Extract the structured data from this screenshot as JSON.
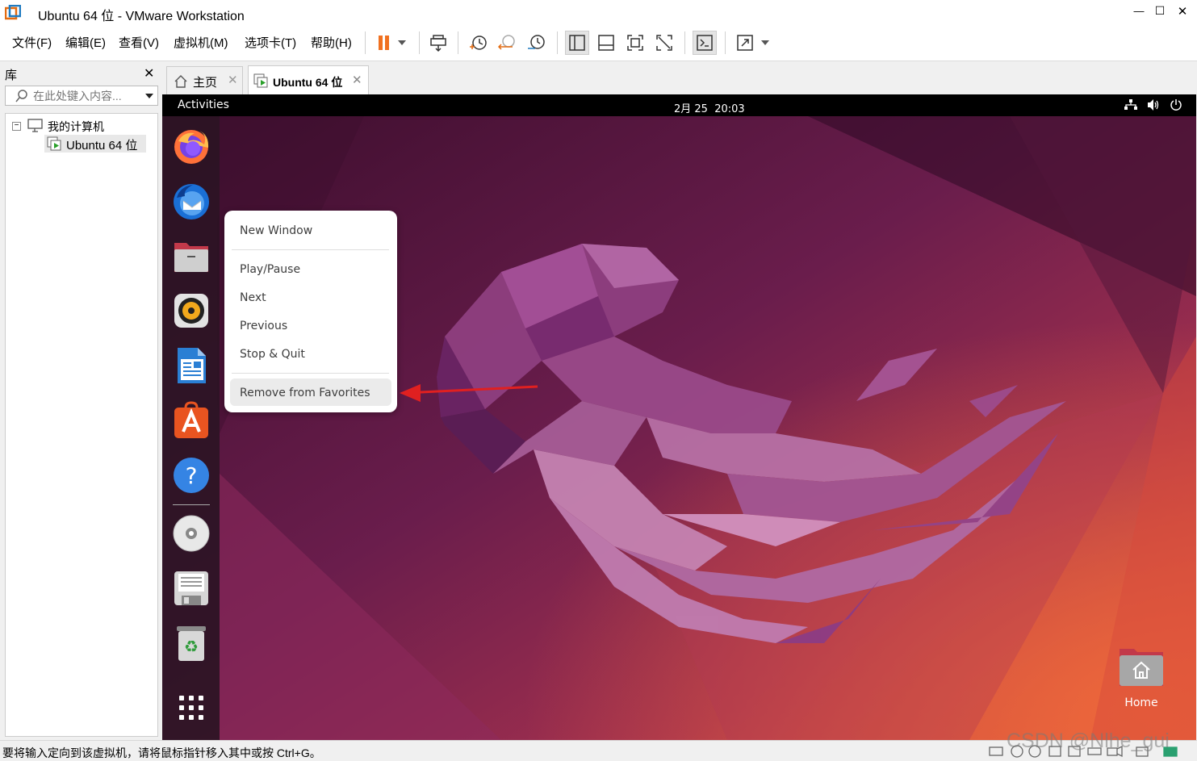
{
  "window": {
    "title": "Ubuntu 64 位 - VMware Workstation",
    "controls": [
      "—",
      "☐",
      "✕"
    ]
  },
  "menu": [
    "文件(F)",
    "编辑(E)",
    "查看(V)",
    "虚拟机(M)",
    "选项卡(T)",
    "帮助(H)"
  ],
  "library": {
    "title": "库",
    "search_placeholder": "在此处键入内容...",
    "tree": {
      "root": "我的计算机",
      "child": "Ubuntu 64 位"
    }
  },
  "tabs": [
    {
      "label": "主页",
      "icon": "home-icon",
      "active": false
    },
    {
      "label": "Ubuntu 64 位",
      "icon": "vm-icon",
      "active": true
    }
  ],
  "ubuntu": {
    "activities": "Activities",
    "clock": "2月 25  20:03",
    "desktop_home": "Home",
    "dock": [
      "firefox-icon",
      "thunderbird-icon",
      "files-icon",
      "rhythmbox-icon",
      "writer-icon",
      "software-icon",
      "help-icon",
      "dvd-icon",
      "floppy-icon",
      "trash-icon",
      "app-grid-icon"
    ],
    "context_menu": {
      "new_window": "New Window",
      "play_pause": "Play/Pause",
      "next": "Next",
      "previous": "Previous",
      "stop_quit": "Stop & Quit",
      "remove_fav": "Remove from Favorites"
    }
  },
  "status": {
    "text": "要将输入定向到该虚拟机，请将鼠标指针移入其中或按 Ctrl+G。",
    "watermark": "CSDN @Nlhe_gui"
  },
  "colors": {
    "accent_orange": "#e95420",
    "menu_highlight": "#ebebeb",
    "arrow": "#e02020",
    "pause": "#f07020"
  }
}
